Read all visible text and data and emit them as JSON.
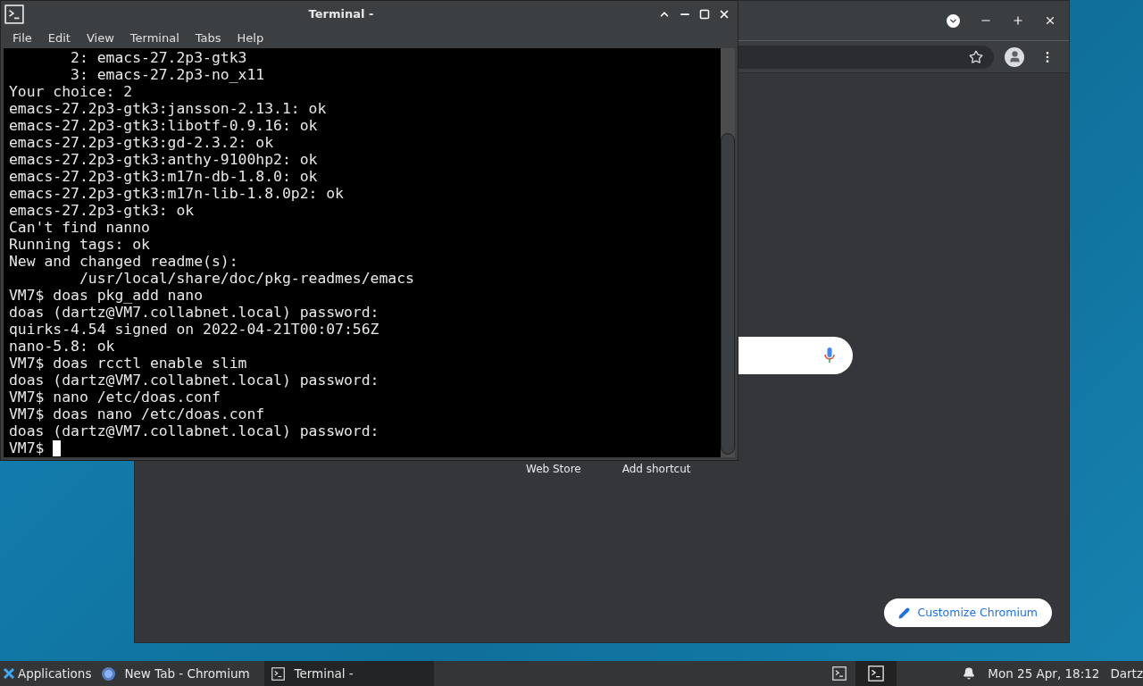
{
  "browser": {
    "shortcuts": [
      "Web Store",
      "Add shortcut"
    ],
    "customize_button": "Customize Chromium"
  },
  "terminal": {
    "title": "Terminal -",
    "menu": [
      "File",
      "Edit",
      "View",
      "Terminal",
      "Tabs",
      "Help"
    ],
    "lines": [
      "       2: emacs-27.2p3-gtk3",
      "       3: emacs-27.2p3-no_x11",
      "Your choice: 2",
      "emacs-27.2p3-gtk3:jansson-2.13.1: ok",
      "emacs-27.2p3-gtk3:libotf-0.9.16: ok",
      "emacs-27.2p3-gtk3:gd-2.3.2: ok",
      "emacs-27.2p3-gtk3:anthy-9100hp2: ok",
      "emacs-27.2p3-gtk3:m17n-db-1.8.0: ok",
      "emacs-27.2p3-gtk3:m17n-lib-1.8.0p2: ok",
      "emacs-27.2p3-gtk3: ok",
      "Can't find nanno",
      "Running tags: ok",
      "New and changed readme(s):",
      "        /usr/local/share/doc/pkg-readmes/emacs",
      "VM7$ doas pkg_add nano",
      "doas (dartz@VM7.collabnet.local) password:",
      "quirks-4.54 signed on 2022-04-21T00:07:56Z",
      "nano-5.8: ok",
      "VM7$ doas rcctl enable slim",
      "doas (dartz@VM7.collabnet.local) password:",
      "VM7$ nano /etc/doas.conf",
      "VM7$ doas nano /etc/doas.conf",
      "doas (dartz@VM7.collabnet.local) password:"
    ],
    "prompt": "VM7$ "
  },
  "taskbar": {
    "menu": "Applications",
    "tasks": [
      {
        "kind": "browser",
        "label": "New Tab - Chromium",
        "selected": false
      },
      {
        "kind": "terminal",
        "label": "Terminal -",
        "selected": true
      }
    ],
    "clock": "Mon 25 Apr, 18:12",
    "user": "Dartz"
  }
}
